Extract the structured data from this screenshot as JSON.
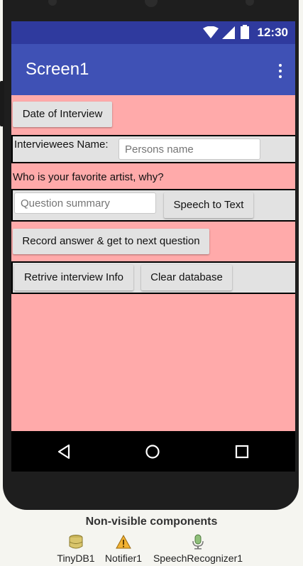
{
  "status": {
    "time": "12:30"
  },
  "appbar": {
    "title": "Screen1"
  },
  "buttons": {
    "date": "Date of Interview",
    "speech": "Speech to Text",
    "record": "Record answer & get to next question",
    "retrieve": "Retrive interview Info",
    "clear": "Clear database"
  },
  "labels": {
    "interviewee": "Interviewees Name:",
    "question": "Who is your favorite artist, why?"
  },
  "fields": {
    "name_placeholder": "Persons name",
    "summary_placeholder": "Question summary"
  },
  "nonvisible": {
    "heading": "Non-visible components",
    "components": [
      "TinyDB1",
      "Notifier1",
      "SpeechRecognizer1"
    ]
  },
  "colors": {
    "screen_bg": "#ffaaaa",
    "appbar": "#3f51b5",
    "statusbar": "#2f3a9e"
  }
}
